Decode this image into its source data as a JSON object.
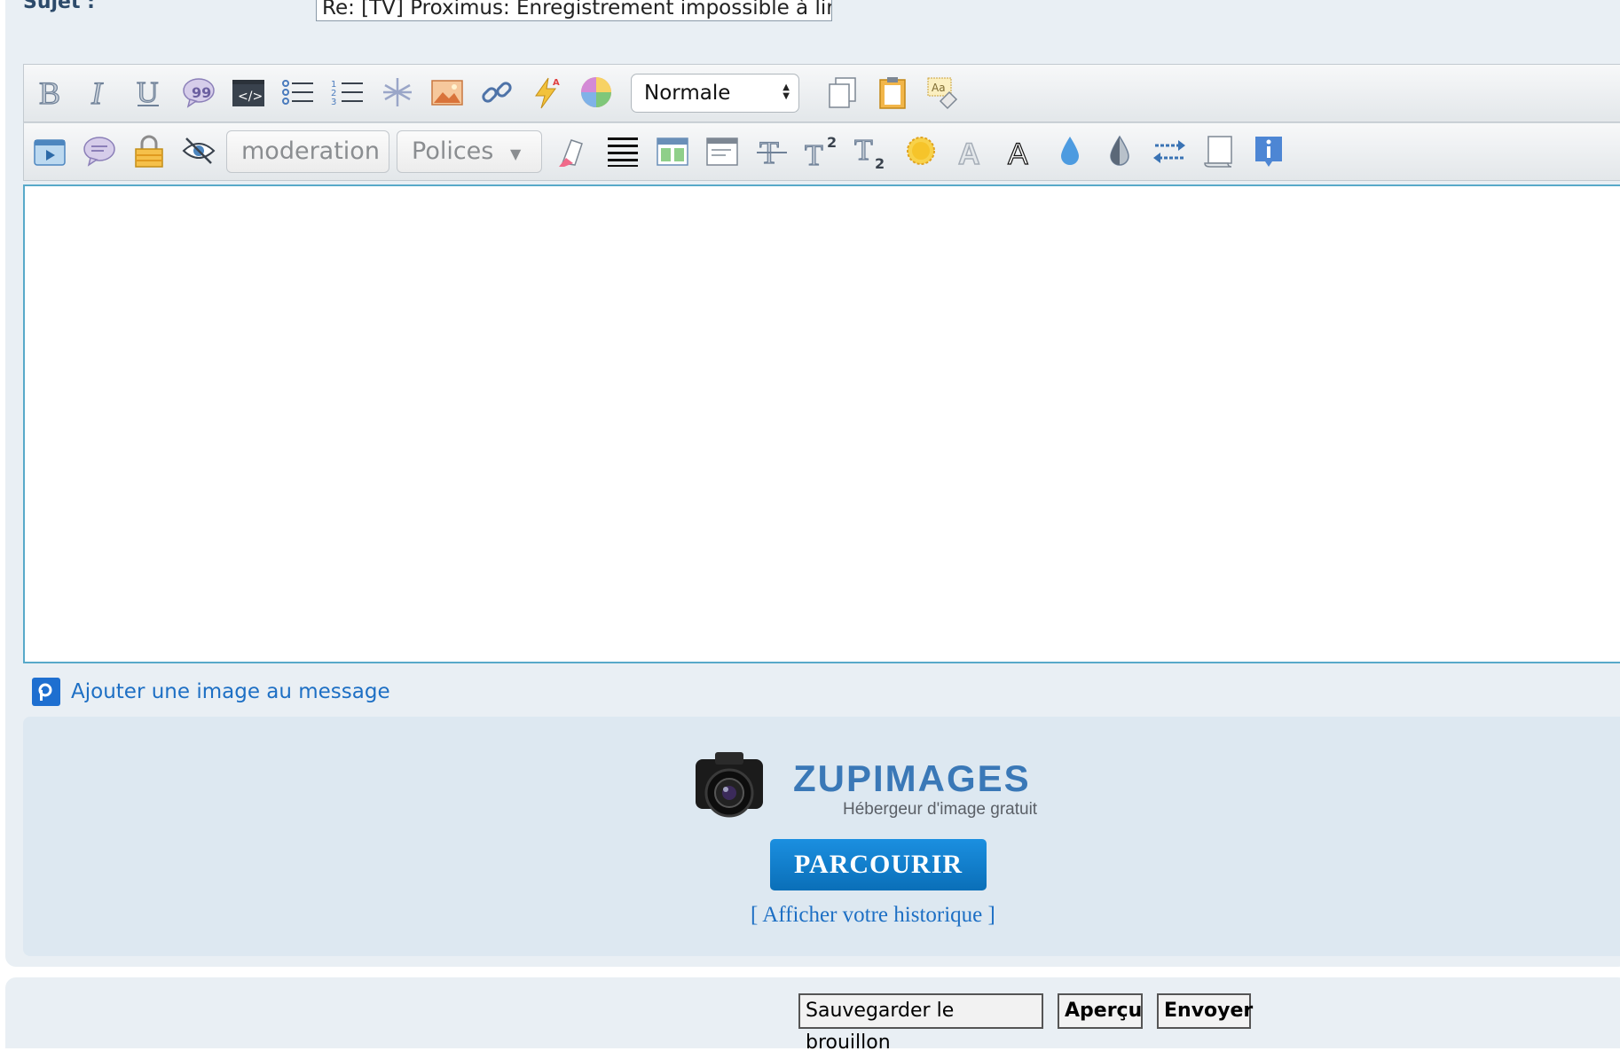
{
  "subject": {
    "label": "Sujet :",
    "value": "Re: [TV] Proximus: Enregistrement impossible à lire"
  },
  "toolbar1": {
    "font_size_select": "Normale",
    "icons": [
      "bold-icon",
      "italic-icon",
      "underline-icon",
      "quote-icon",
      "code-icon",
      "bullet-list-icon",
      "numbered-list-icon",
      "asterisk-icon",
      "image-icon",
      "link-icon",
      "flash-icon",
      "color-wheel-icon",
      "copy-icon",
      "paste-icon",
      "remove-format-icon"
    ]
  },
  "toolbar2": {
    "moderation_label": "moderation",
    "polices_label": "Polices",
    "icons": [
      "video-icon",
      "speech-bubble-icon",
      "lock-icon",
      "hidden-eye-icon",
      "highlighter-icon",
      "align-justify-icon",
      "table-icon",
      "window-icon",
      "strikethrough-icon",
      "superscript-icon",
      "subscript-icon",
      "sun-icon",
      "outline-text-icon",
      "outline-a-icon",
      "drop-icon",
      "contrast-icon",
      "swap-arrows-icon",
      "scroll-icon",
      "info-icon"
    ]
  },
  "upload": {
    "add_image_label": "Ajouter une image au message",
    "brand_title": "ZUPIMAGES",
    "brand_subtitle": "Hébergeur d'image gratuit",
    "browse_label": "PARCOURIR",
    "history_label": "[ Afficher votre historique ]"
  },
  "footer": {
    "save_draft_label": "Sauvegarder le brouillon",
    "preview_label": "Aperçu",
    "send_label": "Envoyer"
  }
}
